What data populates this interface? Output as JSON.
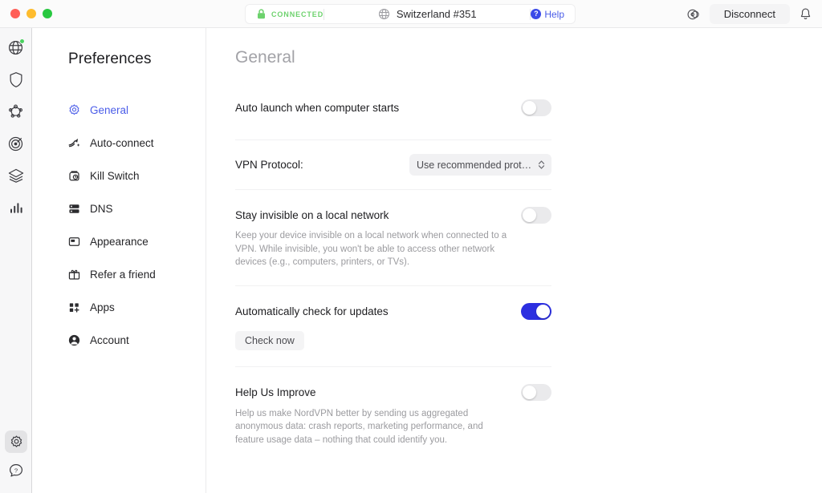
{
  "window": {
    "traffic_lights": [
      "close",
      "minimize",
      "maximize"
    ]
  },
  "titlebar": {
    "connection_status": "CONNECTED",
    "server": "Switzerland #351",
    "help_label": "Help",
    "help_badge": "?",
    "disconnect_label": "Disconnect",
    "icons": {
      "lock": "lock-icon",
      "globe": "globe-icon",
      "meshnet": "meshnet-icon",
      "notifications": "bell-icon"
    }
  },
  "rail": {
    "items": [
      {
        "name": "vpn",
        "icon": "globe-icon",
        "badge": true
      },
      {
        "name": "threat-protection",
        "icon": "shield-icon",
        "badge": false
      },
      {
        "name": "meshnet",
        "icon": "mesh-network-icon",
        "badge": false
      },
      {
        "name": "dark-web-monitor",
        "icon": "target-icon",
        "badge": false
      },
      {
        "name": "file-sharing",
        "icon": "layers-icon",
        "badge": false
      },
      {
        "name": "statistics",
        "icon": "bar-chart-icon",
        "badge": false
      }
    ],
    "bottom": [
      {
        "name": "settings",
        "icon": "gear-icon",
        "active": true
      },
      {
        "name": "help",
        "icon": "help-bubble-icon",
        "active": false
      }
    ]
  },
  "sidebar": {
    "title": "Preferences",
    "items": [
      {
        "label": "General",
        "icon": "gear-icon",
        "active": true
      },
      {
        "label": "Auto-connect",
        "icon": "autoconnect-icon",
        "active": false
      },
      {
        "label": "Kill Switch",
        "icon": "kill-switch-icon",
        "active": false
      },
      {
        "label": "DNS",
        "icon": "dns-icon",
        "active": false
      },
      {
        "label": "Appearance",
        "icon": "appearance-icon",
        "active": false
      },
      {
        "label": "Refer a friend",
        "icon": "gift-icon",
        "active": false
      },
      {
        "label": "Apps",
        "icon": "apps-icon",
        "active": false
      },
      {
        "label": "Account",
        "icon": "account-icon",
        "active": false
      }
    ]
  },
  "main": {
    "title": "General",
    "settings": [
      {
        "key": "auto_launch",
        "title": "Auto launch when computer starts",
        "description": "",
        "control": "toggle",
        "value": "off"
      },
      {
        "key": "vpn_protocol",
        "title": "VPN Protocol:",
        "description": "",
        "control": "select",
        "value": "Use recommended proto…"
      },
      {
        "key": "local_network_invisibility",
        "title": "Stay invisible on a local network",
        "description": "Keep your device invisible on a local network when connected to a VPN. While invisible, you won't be able to access other network devices (e.g., computers, printers, or TVs).",
        "control": "toggle",
        "value": "off"
      },
      {
        "key": "auto_update",
        "title": "Automatically check for updates",
        "description": "",
        "control": "toggle",
        "value": "on",
        "button_label": "Check now"
      },
      {
        "key": "help_us_improve",
        "title": "Help Us Improve",
        "description": "Help us make NordVPN better by sending us aggregated anonymous data: crash reports, marketing performance, and feature usage data – nothing that could identify you.",
        "control": "toggle",
        "value": "off"
      }
    ]
  },
  "colors": {
    "accent_blue": "#4a5ce8",
    "toggle_on": "#2c2fe0",
    "status_green": "#6dd26d",
    "title_gray": "#a2a2a7"
  }
}
